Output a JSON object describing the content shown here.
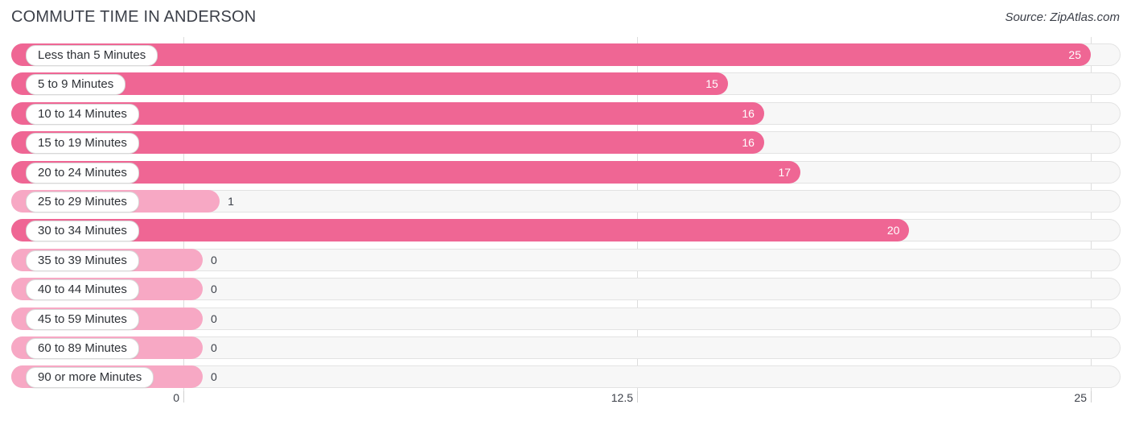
{
  "header": {
    "title": "COMMUTE TIME IN ANDERSON",
    "source": "Source: ZipAtlas.com"
  },
  "colors": {
    "bar_high": "#ef6694",
    "bar_low": "#f7a8c4",
    "track": "#f7f7f7",
    "text": "#3c4049"
  },
  "chart_data": {
    "type": "bar",
    "orientation": "horizontal",
    "title": "COMMUTE TIME IN ANDERSON",
    "xlabel": "",
    "ylabel": "",
    "xlim": [
      0,
      25
    ],
    "grid": true,
    "legend": false,
    "axis_ticks": [
      "0",
      "12.5",
      "25"
    ],
    "axis_tick_values": [
      0,
      12.5,
      25
    ],
    "categories": [
      "Less than 5 Minutes",
      "5 to 9 Minutes",
      "10 to 14 Minutes",
      "15 to 19 Minutes",
      "20 to 24 Minutes",
      "25 to 29 Minutes",
      "30 to 34 Minutes",
      "35 to 39 Minutes",
      "40 to 44 Minutes",
      "45 to 59 Minutes",
      "60 to 89 Minutes",
      "90 or more Minutes"
    ],
    "values": [
      25,
      15,
      16,
      16,
      17,
      1,
      20,
      0,
      0,
      0,
      0,
      0
    ],
    "value_labels": [
      "25",
      "15",
      "16",
      "16",
      "17",
      "1",
      "20",
      "0",
      "0",
      "0",
      "0",
      "0"
    ]
  }
}
